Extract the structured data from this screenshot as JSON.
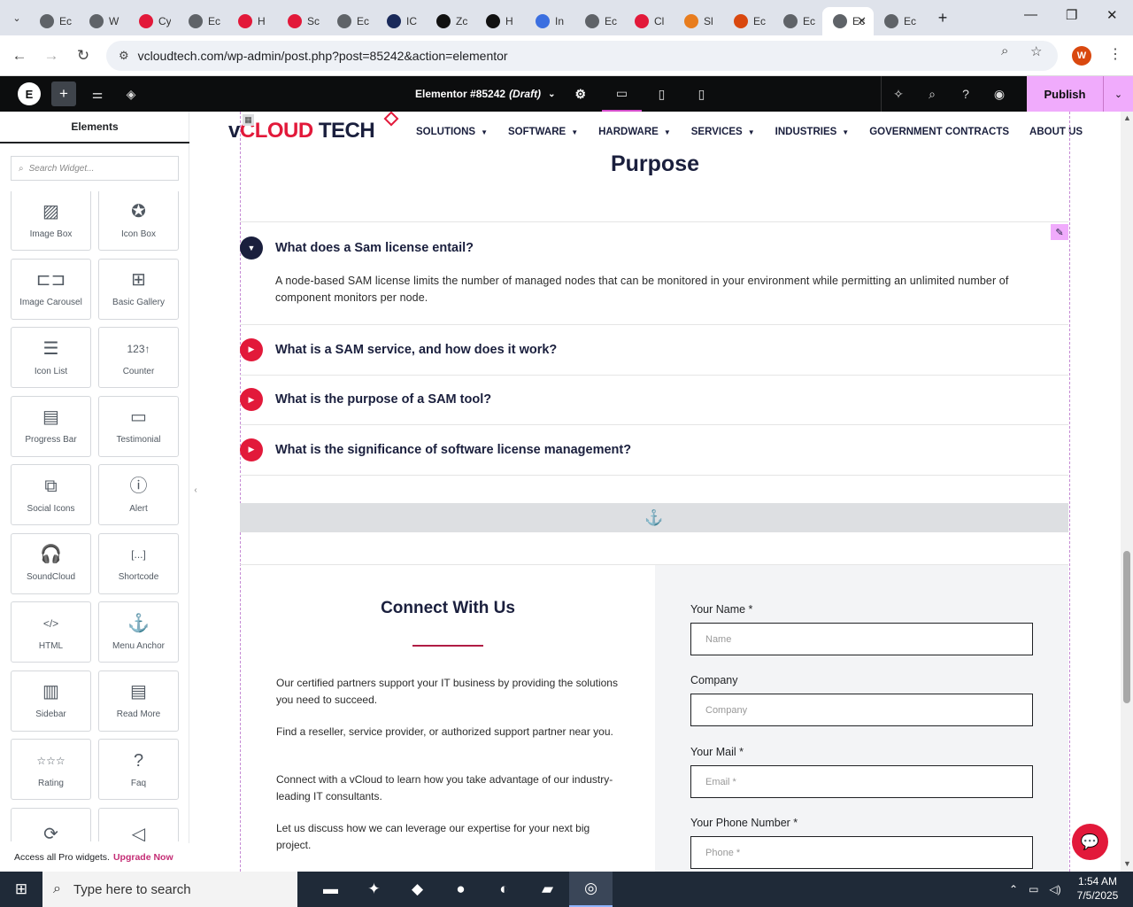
{
  "browser": {
    "tabs": [
      {
        "label": "Ec",
        "icon": "globe-icon",
        "color": "#5f6368"
      },
      {
        "label": "W",
        "icon": "globe-icon",
        "color": "#5f6368"
      },
      {
        "label": "Cy",
        "icon": "diamond-icon",
        "color": "#e2193a"
      },
      {
        "label": "Ec",
        "icon": "globe-icon",
        "color": "#5f6368"
      },
      {
        "label": "H",
        "icon": "diamond-icon",
        "color": "#e2193a"
      },
      {
        "label": "Sc",
        "icon": "diamond-icon",
        "color": "#e2193a"
      },
      {
        "label": "Ec",
        "icon": "globe-icon",
        "color": "#5f6368"
      },
      {
        "label": "IC",
        "icon": "n-icon",
        "color": "#1a2a5a"
      },
      {
        "label": "Zc",
        "icon": "z-icon",
        "color": "#111111"
      },
      {
        "label": "H",
        "icon": "openai-icon",
        "color": "#111111"
      },
      {
        "label": "In",
        "icon": "flow-icon",
        "color": "#3b6fe0"
      },
      {
        "label": "Ec",
        "icon": "globe-icon",
        "color": "#5f6368"
      },
      {
        "label": "Cl",
        "icon": "slash-icon",
        "color": "#e2193a"
      },
      {
        "label": "Sl",
        "icon": "ring-icon",
        "color": "#e87d1e"
      },
      {
        "label": "Ec",
        "icon": "box-icon",
        "color": "#d9480f"
      },
      {
        "label": "Ec",
        "icon": "globe-icon",
        "color": "#5f6368"
      },
      {
        "label": "Ec",
        "icon": "globe-icon",
        "color": "#5f6368",
        "active": true
      },
      {
        "label": "Ec",
        "icon": "globe-icon",
        "color": "#5f6368"
      }
    ],
    "url": "vcloudtech.com/wp-admin/post.php?post=85242&action=elementor",
    "profile_initial": "W"
  },
  "elementor": {
    "doc_title": "Elementor #85242",
    "doc_status": "(Draft)",
    "publish_label": "Publish",
    "panel_title": "Elements",
    "search_placeholder": "Search Widget...",
    "widgets": [
      {
        "label": "Image Box",
        "icon": "image-box-icon",
        "glyph": "▨"
      },
      {
        "label": "Icon Box",
        "icon": "icon-box-icon",
        "glyph": "✪"
      },
      {
        "label": "Image Carousel",
        "icon": "image-carousel-icon",
        "glyph": "⊏⊐"
      },
      {
        "label": "Basic Gallery",
        "icon": "gallery-icon",
        "glyph": "⊞"
      },
      {
        "label": "Icon List",
        "icon": "icon-list-icon",
        "glyph": "☰"
      },
      {
        "label": "Counter",
        "icon": "counter-icon",
        "glyph": "123↑"
      },
      {
        "label": "Progress Bar",
        "icon": "progress-bar-icon",
        "glyph": "▤"
      },
      {
        "label": "Testimonial",
        "icon": "testimonial-icon",
        "glyph": "▭"
      },
      {
        "label": "Social Icons",
        "icon": "social-icons-icon",
        "glyph": "⧉"
      },
      {
        "label": "Alert",
        "icon": "alert-icon",
        "glyph": "ⓘ"
      },
      {
        "label": "SoundCloud",
        "icon": "soundcloud-icon",
        "glyph": "🎧"
      },
      {
        "label": "Shortcode",
        "icon": "shortcode-icon",
        "glyph": "[...]"
      },
      {
        "label": "HTML",
        "icon": "html-icon",
        "glyph": "</>"
      },
      {
        "label": "Menu Anchor",
        "icon": "anchor-icon",
        "glyph": "⚓"
      },
      {
        "label": "Sidebar",
        "icon": "sidebar-icon",
        "glyph": "▥"
      },
      {
        "label": "Read More",
        "icon": "read-more-icon",
        "glyph": "▤"
      },
      {
        "label": "Rating",
        "icon": "rating-icon",
        "glyph": "☆☆☆"
      },
      {
        "label": "Faq",
        "icon": "faq-icon",
        "glyph": "?"
      },
      {
        "label": "",
        "icon": "lottie-icon",
        "glyph": "⟳"
      },
      {
        "label": "",
        "icon": "paper-plane-icon",
        "glyph": "◁"
      }
    ],
    "promo_text": "Access all Pro widgets.",
    "promo_link": "Upgrade Now"
  },
  "site": {
    "logo_v": "v",
    "logo_cloud": "CLOUD",
    "logo_tech": " TECH",
    "menu": [
      {
        "label": "SOLUTIONS",
        "dropdown": true
      },
      {
        "label": "SOFTWARE",
        "dropdown": true
      },
      {
        "label": "HARDWARE",
        "dropdown": true
      },
      {
        "label": "SERVICES",
        "dropdown": true
      },
      {
        "label": "INDUSTRIES",
        "dropdown": true
      },
      {
        "label": "GOVERNMENT CONTRACTS",
        "dropdown": false
      },
      {
        "label": "ABOUT US",
        "dropdown": false
      }
    ],
    "section_title": "Purpose",
    "faq": [
      {
        "question": "What does a Sam license entail?",
        "open": true,
        "answer": "A node-based SAM license limits the number of managed nodes that can be monitored in your environment while permitting an unlimited number of component monitors per node."
      },
      {
        "question": "What is a SAM service, and how does it work?",
        "open": false
      },
      {
        "question": "What is the purpose of a SAM tool?",
        "open": false
      },
      {
        "question": "What is the significance of software license management?",
        "open": false
      }
    ],
    "connect": {
      "title": "Connect With Us",
      "paragraphs": [
        "Our certified partners support your IT business by providing the solutions you need to succeed.",
        "Find a reseller, service provider, or authorized support partner near you.",
        "Connect with a vCloud to learn how you take advantage of our industry-leading IT consultants.",
        "Let us discuss how we can leverage our expertise for your next big project."
      ]
    },
    "form": [
      {
        "label": "Your Name *",
        "placeholder": "Name"
      },
      {
        "label": "Company",
        "placeholder": "Company"
      },
      {
        "label": "Your Mail *",
        "placeholder": "Email *"
      },
      {
        "label": "Your Phone Number *",
        "placeholder": "Phone *"
      }
    ],
    "brand_color": "#e2193a",
    "navy_color": "#1a1f3d"
  },
  "taskbar": {
    "search_placeholder": "Type here to search",
    "time": "1:54 AM",
    "date": "7/5/2025"
  }
}
